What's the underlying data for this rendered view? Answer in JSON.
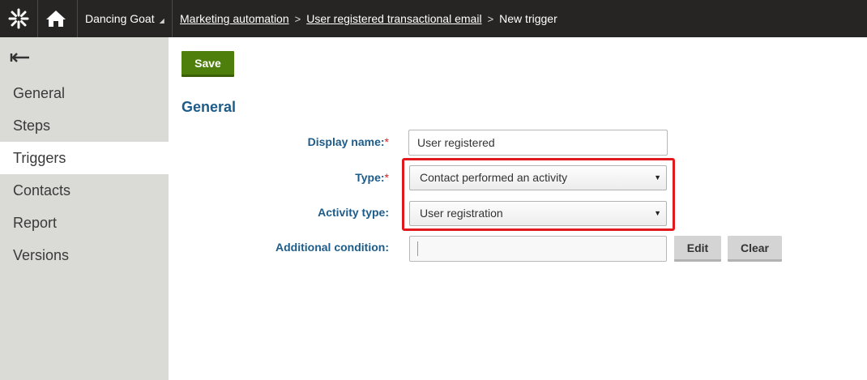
{
  "header": {
    "site_name": "Dancing Goat",
    "breadcrumb": {
      "item1": "Marketing automation",
      "item2": "User registered transactional email",
      "current": "New trigger"
    }
  },
  "sidebar": {
    "items": [
      {
        "label": "General"
      },
      {
        "label": "Steps"
      },
      {
        "label": "Triggers"
      },
      {
        "label": "Contacts"
      },
      {
        "label": "Report"
      },
      {
        "label": "Versions"
      }
    ],
    "active": "Triggers"
  },
  "toolbar": {
    "save_label": "Save"
  },
  "form": {
    "section_title": "General",
    "display_name": {
      "label": "Display name:",
      "required_mark": "*",
      "value": "User registered"
    },
    "type": {
      "label": "Type:",
      "required_mark": "*",
      "value": "Contact performed an activity"
    },
    "activity_type": {
      "label": "Activity type:",
      "value": "User registration"
    },
    "additional_condition": {
      "label": "Additional condition:",
      "value": "",
      "edit_label": "Edit",
      "clear_label": "Clear"
    }
  },
  "colors": {
    "topbar": "#262524",
    "sidebar": "#dadbd7",
    "accent_green": "#4e7f0c",
    "label_blue": "#1d5c8a",
    "highlight_red": "#e2191c"
  }
}
